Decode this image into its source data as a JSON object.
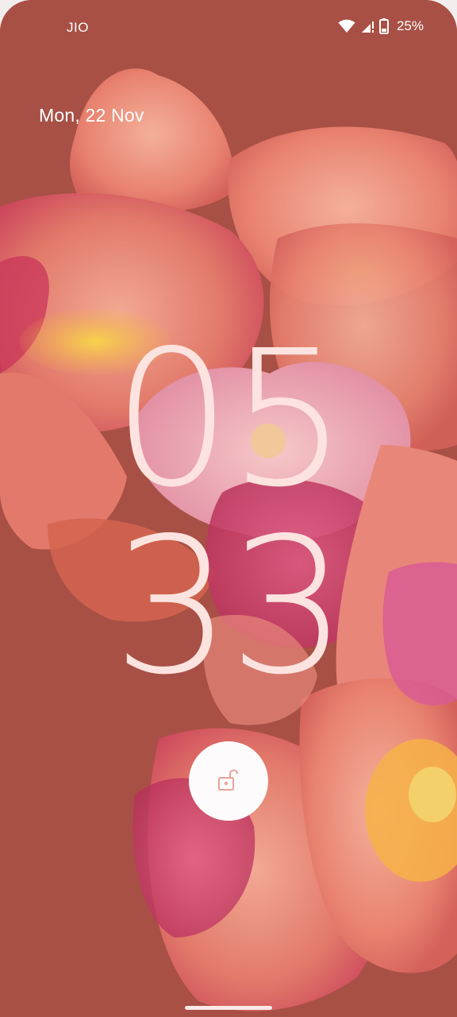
{
  "status_bar": {
    "carrier": "JIO",
    "battery_percent": "25%",
    "icons": [
      "wifi-icon",
      "cell-signal-icon",
      "battery-icon"
    ]
  },
  "lock_screen": {
    "date": "Mon, 22 Nov",
    "clock_hours": "05",
    "clock_minutes": "33",
    "unlock_icon": "unlock-icon"
  },
  "colors": {
    "background": "#a85045",
    "clock_text": "#fde3df",
    "unlock_button": "#fdfbfb",
    "unlock_icon": "#e8a39a"
  }
}
